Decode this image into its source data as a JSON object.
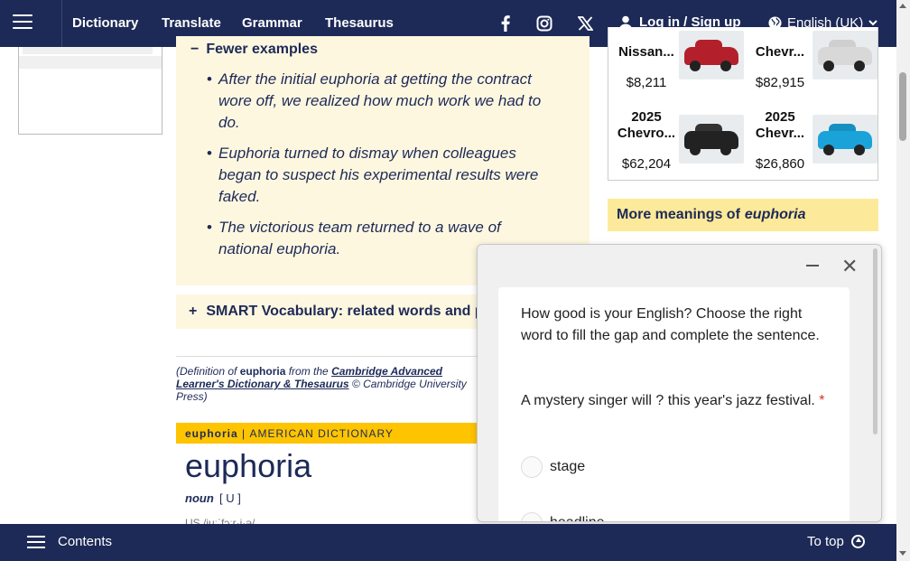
{
  "nav": {
    "links": [
      "Dictionary",
      "Translate",
      "Grammar",
      "Thesaurus"
    ],
    "login": "Log in / Sign up",
    "language": "English (UK)"
  },
  "examples": {
    "toggle_label": "Fewer examples",
    "items": [
      "After the initial euphoria at getting the contract wore off, we realized how much work we had to do.",
      "Euphoria turned to dismay when colleagues began to suspect his experimental results were faked.",
      "The victorious team returned to a wave of national euphoria."
    ]
  },
  "smart_vocab": "SMART Vocabulary: related words and phrases",
  "citation": {
    "prefix": "(Definition of ",
    "word": "euphoria",
    "middle": " from the ",
    "source": "Cambridge Advanced Learner's Dictionary & Thesaurus",
    "suffix": " © Cambridge University Press)"
  },
  "american": {
    "label_word": "euphoria",
    "label_dict": "AMERICAN DICTIONARY",
    "headword": "euphoria",
    "pos": "noun",
    "grammar": "[ U ]",
    "pron_hint": "US  /juːˈfɔːr·i·ə/"
  },
  "ads": [
    {
      "year": "",
      "model": "Nissan...",
      "price": "$8,211",
      "color": "#b3202c"
    },
    {
      "year": "",
      "model": "Chevr...",
      "price": "$82,915",
      "color": "#d8d8d8"
    },
    {
      "year": "2025",
      "model": "Chevro...",
      "price": "$62,204",
      "color": "#222222"
    },
    {
      "year": "2025",
      "model": "Chevr...",
      "price": "$26,860",
      "color": "#1aa3d9"
    }
  ],
  "more_meanings": {
    "prefix": "More meanings of",
    "word": "euphoria"
  },
  "quiz": {
    "intro": "How good is your English? Choose the right word to fill the gap and complete the sentence.",
    "question": "A mystery singer will ? this year's jazz festival.",
    "required_mark": "*",
    "options": [
      "stage",
      "headline"
    ]
  },
  "bottom": {
    "contents": "Contents",
    "to_top": "To top"
  },
  "colors": {
    "navy": "#1d2a57",
    "yellow": "#fec400",
    "cream": "#fef7e0"
  }
}
